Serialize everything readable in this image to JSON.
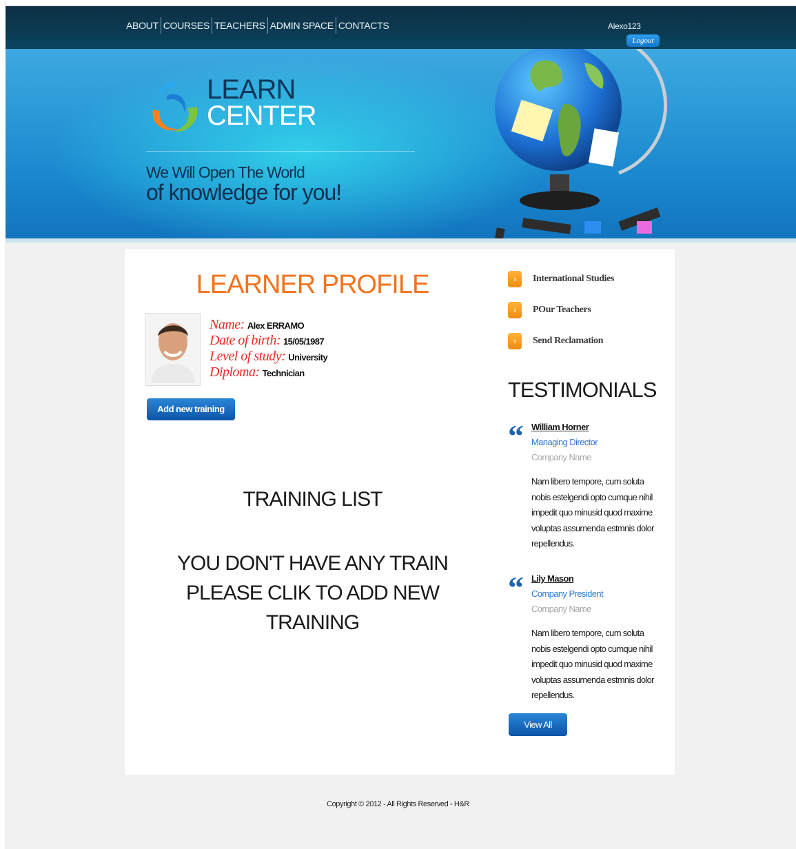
{
  "nav": {
    "items": [
      "ABOUT",
      "COURSES",
      "TEACHERS",
      "ADMIN SPACE",
      "CONTACTS"
    ]
  },
  "user": {
    "name": "Alexo123",
    "logout_label": "Logout"
  },
  "hero": {
    "logo_line1": "LEARN",
    "logo_line2": "CENTER",
    "tagline_line1": "We Will Open The World",
    "tagline_line2": "of knowledge for you!"
  },
  "profile": {
    "title": "LEARNER PROFILE",
    "fields": [
      {
        "label": "Name:",
        "value": "Alex ERRAMO"
      },
      {
        "label": "Date of birth:",
        "value": "15/05/1987"
      },
      {
        "label": "Level of study:",
        "value": "University"
      },
      {
        "label": "Diploma:",
        "value": "Technician"
      }
    ],
    "add_training_label": "Add new training"
  },
  "training": {
    "title": "TRAINING LIST",
    "empty_message": "YOU DON'T HAVE ANY TRAIN PLEASE CLIK TO ADD NEW TRAINING"
  },
  "sidebar": {
    "links": [
      "International Studies",
      "POur Teachers",
      "Send Reclamation"
    ],
    "testimonials_title": "TESTIMONIALS",
    "testimonials": [
      {
        "name": "William Horner",
        "role": "Managing Director",
        "company": "Company Name",
        "text": "Nam libero tempore, cum soluta nobis estelgendi opto cumque nihil impedit quo minusid quod maxime voluptas assumenda estmnis dolor repellendus."
      },
      {
        "name": "Lily Mason",
        "role": "Company President",
        "company": "Company Name",
        "text": "Nam libero tempore, cum soluta nobis estelgendi opto cumque nihil impedit quo minusid quod maxime voluptas assumenda estmnis dolor repellendus."
      }
    ],
    "view_all_label": "View All"
  },
  "footer": {
    "copyright": "Copyright © 2012 - All Rights Reserved - H&R"
  },
  "colors": {
    "accent_orange": "#f2731e",
    "profile_label_red": "#ee2a2a",
    "button_blue": "#0c55a7",
    "header_dark": "#0b3a52"
  }
}
